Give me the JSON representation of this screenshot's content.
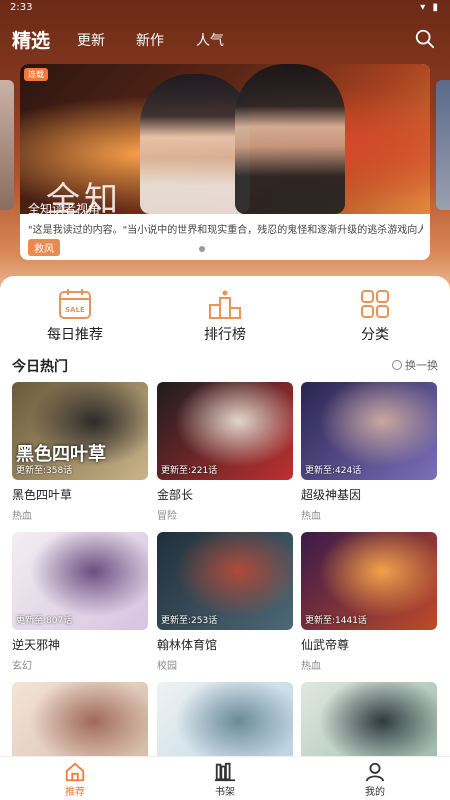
{
  "status": {
    "time": "2:33",
    "icons": "▾ ▮"
  },
  "topnav": {
    "tabs": [
      {
        "label": "精选",
        "active": true
      },
      {
        "label": "更新",
        "active": false
      },
      {
        "label": "新作",
        "active": false
      },
      {
        "label": "人气",
        "active": false
      }
    ],
    "search_icon": "search-icon"
  },
  "banner": {
    "badge": "连载",
    "big_title": "全知",
    "title": "全知读者视角",
    "description": "\"这是我读过的内容。\"当小说中的世界和现实重合，残忍的鬼怪和逐渐升级的逃杀游戏向人们袭来。唯一...",
    "tag": "救风"
  },
  "features": [
    {
      "label": "每日推荐",
      "icon": "calendar-sale-icon"
    },
    {
      "label": "排行榜",
      "icon": "podium-icon"
    },
    {
      "label": "分类",
      "icon": "grid-icon"
    }
  ],
  "section": {
    "title": "今日热门",
    "refresh": "换一换"
  },
  "comics": [
    {
      "title": "黑色四叶草",
      "genre": "热血",
      "update": "更新至:358话",
      "cover_text": "黑色四叶草",
      "colors": [
        "#6a5a3a",
        "#c9b48a",
        "#2e2a2a"
      ]
    },
    {
      "title": "金部长",
      "genre": "冒险",
      "update": "更新至:221话",
      "cover_text": "",
      "colors": [
        "#1d1d20",
        "#c03030",
        "#e0d6cc"
      ]
    },
    {
      "title": "超级神基因",
      "genre": "热血",
      "update": "更新至:424话",
      "cover_text": "",
      "colors": [
        "#2a2450",
        "#7b6fb8",
        "#c9a8a0"
      ]
    },
    {
      "title": "逆天邪神",
      "genre": "玄幻",
      "update": "更新至:807话",
      "cover_text": "",
      "colors": [
        "#f3eef2",
        "#d6c3e0",
        "#6b4e80"
      ]
    },
    {
      "title": "翰林体育馆",
      "genre": "校园",
      "update": "更新至:253话",
      "cover_text": "",
      "colors": [
        "#1f2f3a",
        "#4e6876",
        "#b04a3a"
      ]
    },
    {
      "title": "仙武帝尊",
      "genre": "热血",
      "update": "更新至:1441话",
      "cover_text": "",
      "colors": [
        "#3a1a4a",
        "#c04a2a",
        "#f2a24a"
      ]
    },
    {
      "title": "",
      "genre": "",
      "update": "",
      "cover_text": "",
      "colors": [
        "#f3e3d8",
        "#d4b8a4",
        "#a06a5a"
      ]
    },
    {
      "title": "",
      "genre": "",
      "update": "",
      "cover_text": "",
      "colors": [
        "#eef2f4",
        "#b7d2e2",
        "#6a8a9a"
      ]
    },
    {
      "title": "",
      "genre": "",
      "update": "",
      "cover_text": "",
      "colors": [
        "#dfe8e0",
        "#9ab8a8",
        "#2e3a40"
      ]
    }
  ],
  "bottom_nav": [
    {
      "label": "推荐",
      "icon": "home-icon",
      "active": true
    },
    {
      "label": "书架",
      "icon": "bookshelf-icon",
      "active": false
    },
    {
      "label": "我的",
      "icon": "user-icon",
      "active": false
    }
  ]
}
